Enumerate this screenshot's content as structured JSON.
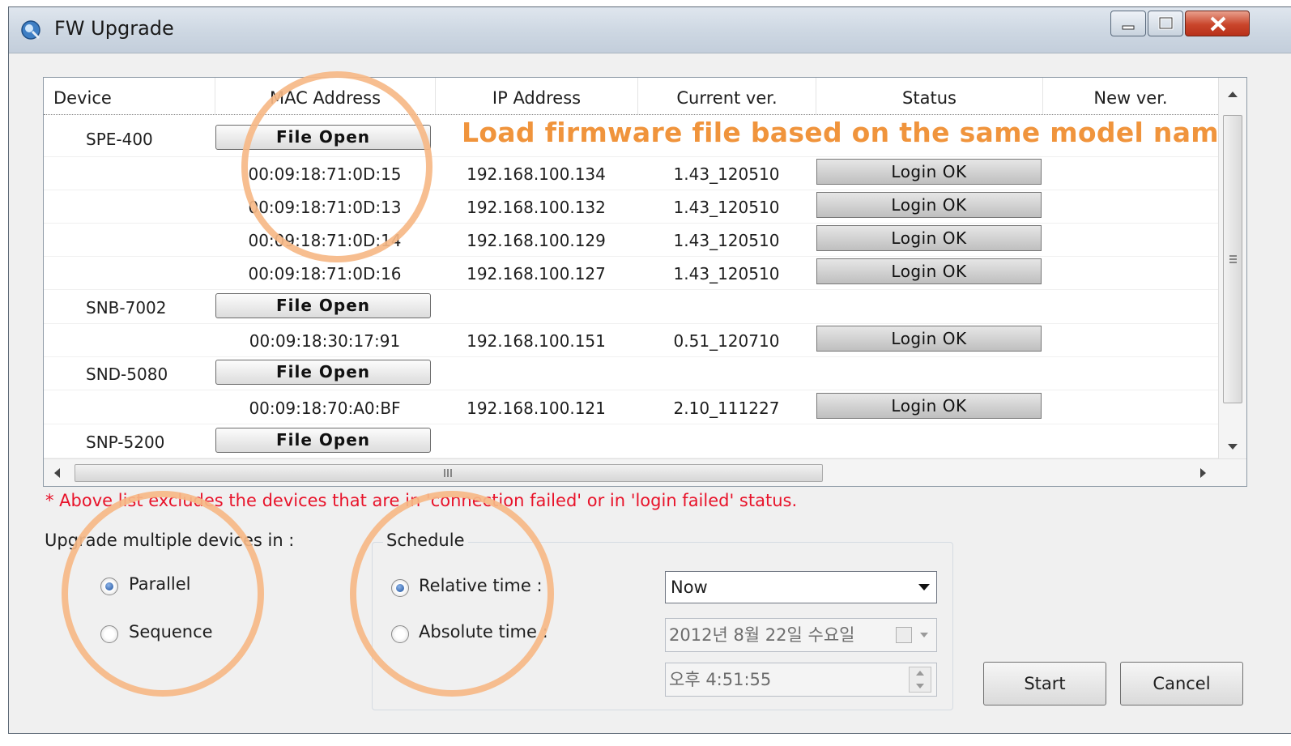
{
  "window": {
    "title": "FW Upgrade"
  },
  "grid": {
    "columns": [
      "Device",
      "MAC Address",
      "IP Address",
      "Current ver.",
      "Status",
      "New ver."
    ],
    "rows": [
      {
        "device": "SPE-400",
        "button": "File Open"
      },
      {
        "mac": "00:09:18:71:0D:15",
        "ip": "192.168.100.134",
        "ver": "1.43_120510",
        "status": "Login OK"
      },
      {
        "mac": "00:09:18:71:0D:13",
        "ip": "192.168.100.132",
        "ver": "1.43_120510",
        "status": "Login OK"
      },
      {
        "mac": "00:09:18:71:0D:14",
        "ip": "192.168.100.129",
        "ver": "1.43_120510",
        "status": "Login OK"
      },
      {
        "mac": "00:09:18:71:0D:16",
        "ip": "192.168.100.127",
        "ver": "1.43_120510",
        "status": "Login OK"
      },
      {
        "device": "SNB-7002",
        "button": "File Open"
      },
      {
        "mac": "00:09:18:30:17:91",
        "ip": "192.168.100.151",
        "ver": "0.51_120710",
        "status": "Login OK"
      },
      {
        "device": "SND-5080",
        "button": "File Open"
      },
      {
        "mac": "00:09:18:70:A0:BF",
        "ip": "192.168.100.121",
        "ver": "2.10_111227",
        "status": "Login OK"
      },
      {
        "device": "SNP-5200",
        "button": "File Open"
      }
    ]
  },
  "annotation": "Load firmware file based on the same model name",
  "note": "*  Above list excludes the devices that are in 'connection failed' or in 'login failed' status.",
  "multi": {
    "label": "Upgrade multiple devices in :",
    "parallel": "Parallel",
    "sequence": "Sequence",
    "selected": "Parallel"
  },
  "schedule": {
    "title": "Schedule",
    "relative": "Relative time :",
    "absolute": "Absolute time :",
    "relative_value": "Now",
    "date_value": "2012년  8월 22일 수요일",
    "time_value": "오후  4:51:55"
  },
  "buttons": {
    "start": "Start",
    "cancel": "Cancel"
  },
  "colors": {
    "annotation": "#f0943c",
    "highlight_circle": "#f6b987",
    "note": "#e8132a"
  }
}
